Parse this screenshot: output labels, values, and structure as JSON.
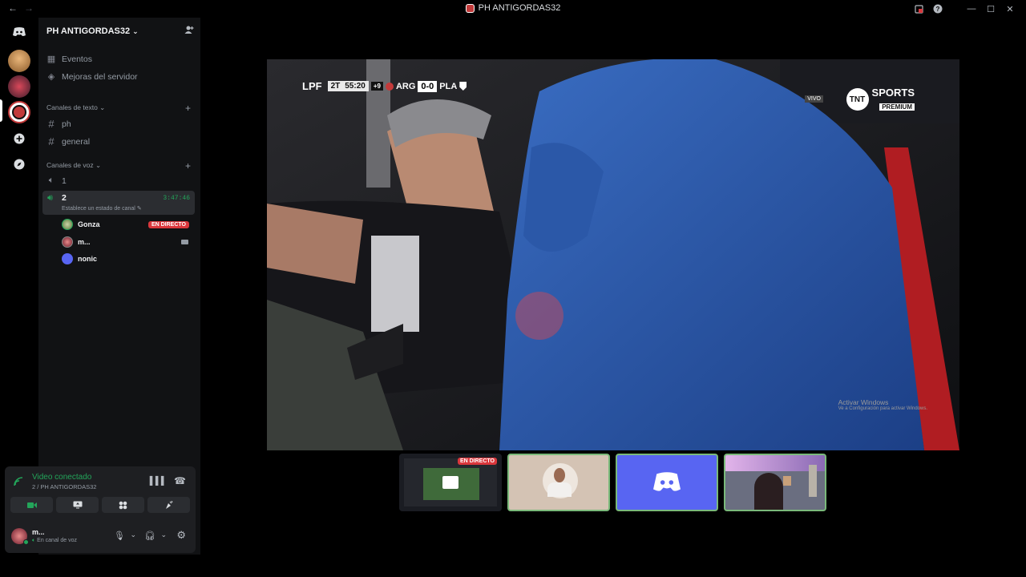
{
  "window": {
    "title": "PH ANTIGORDAS32",
    "back_icon": "arrow-left-icon",
    "forward_icon": "arrow-right-icon"
  },
  "server": {
    "name": "PH ANTIGORDAS32",
    "events_label": "Eventos",
    "boosts_label": "Mejoras del servidor"
  },
  "text_channels": {
    "category": "Canales de texto",
    "channels": [
      "ph",
      "general"
    ]
  },
  "voice_channels": {
    "category": "Canales de voz",
    "channels": [
      {
        "name": "1"
      },
      {
        "name": "2",
        "timer": "3:47:46",
        "status_hint": "Establece un estado de canal"
      }
    ],
    "participants": [
      {
        "name": "Gonza",
        "badge": "EN DIRECTO"
      },
      {
        "name": "m..."
      },
      {
        "name": "nonic"
      }
    ]
  },
  "voice_panel": {
    "status": "Video conectado",
    "location": "2 / PH ANTIGORDAS32"
  },
  "user": {
    "name": "m...",
    "status": "En canal de voz"
  },
  "stream": {
    "league": "LPF",
    "period": "2T",
    "clock": "55:20",
    "added_time": "+9",
    "home": "ARG",
    "score": "0-0",
    "away": "PLA",
    "broadcaster_line1": "SPORTS",
    "broadcaster_line2": "PREMIUM",
    "broadcaster_logo_text": "TNT",
    "live_tag": "VIVO"
  },
  "watermark": {
    "line1": "Activar Windows",
    "line2": "Ve a Configuración para activar Windows."
  },
  "thumbnails": [
    {
      "name": "screen-share",
      "badge": "EN DIRECTO"
    },
    {
      "name": "gonza-camera"
    },
    {
      "name": "nonic-avatar"
    },
    {
      "name": "user-camera"
    }
  ],
  "colors": {
    "green": "#23a55a",
    "live_red": "#da373c",
    "blurple": "#5865f2",
    "sidebar_bg": "#111214"
  }
}
